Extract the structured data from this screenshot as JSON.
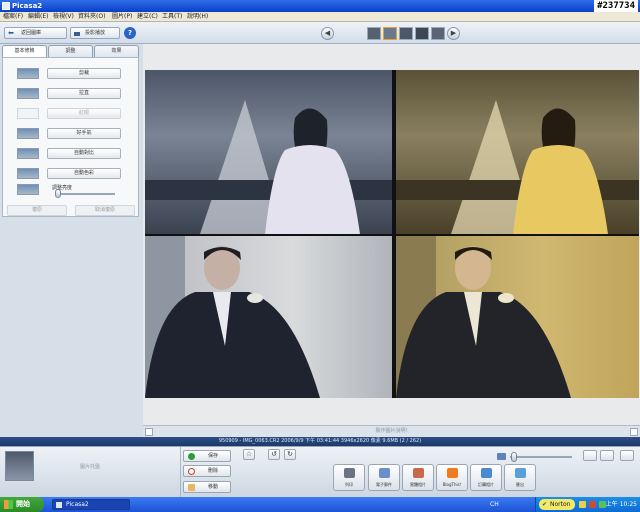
{
  "window": {
    "title": "Picasa2"
  },
  "watermark": "#237734",
  "menu": [
    "檔案(F)",
    "編輯(E)",
    "檢視(V)",
    "資料夾(O)",
    "圖片(P)",
    "建立(C)",
    "工具(T)",
    "說明(H)"
  ],
  "toolbar": {
    "back_label": "返回圖庫",
    "slideshow_label": "投影播放",
    "help_label": "?",
    "prev_label": "◀",
    "next_label": "▶"
  },
  "left_panel": {
    "tabs": [
      "基本修飾",
      "調整",
      "效果"
    ],
    "tools": [
      {
        "label": "剪裁",
        "disabled": false
      },
      {
        "label": "拉直",
        "disabled": false
      },
      {
        "label": "紅眼",
        "disabled": true
      },
      {
        "label": "好手氣",
        "disabled": false
      },
      {
        "label": "自動對比",
        "disabled": false
      },
      {
        "label": "自動色彩",
        "disabled": false
      }
    ],
    "fill_light_label": "調整亮度",
    "undo_label": "復原",
    "redo_label": "取消復原"
  },
  "viewer": {
    "caption": "製作圖片說明!"
  },
  "info_bar": {
    "text": "950909 - IMG_0063.CR2    2006/9/9    下午 03:41:44    3946x2620 像素    9.6MB    (2 / 262)"
  },
  "tray": {
    "label": "圖片托盤",
    "save_label": "保存",
    "delete_label": "刪除",
    "hold_label": "移動",
    "actions": [
      "列印",
      "電子郵件",
      "實體相片",
      "BlogThis!",
      "訂購相片",
      "匯出"
    ]
  },
  "taskbar": {
    "start_label": "開始",
    "task_label": "Picasa2",
    "lang": "CH",
    "norton_label": "Norton",
    "clock": "上午 10:25"
  },
  "colors": {
    "accent": "#2a63c8",
    "taskbar": "#1d52d6",
    "start": "#2b8a26"
  }
}
